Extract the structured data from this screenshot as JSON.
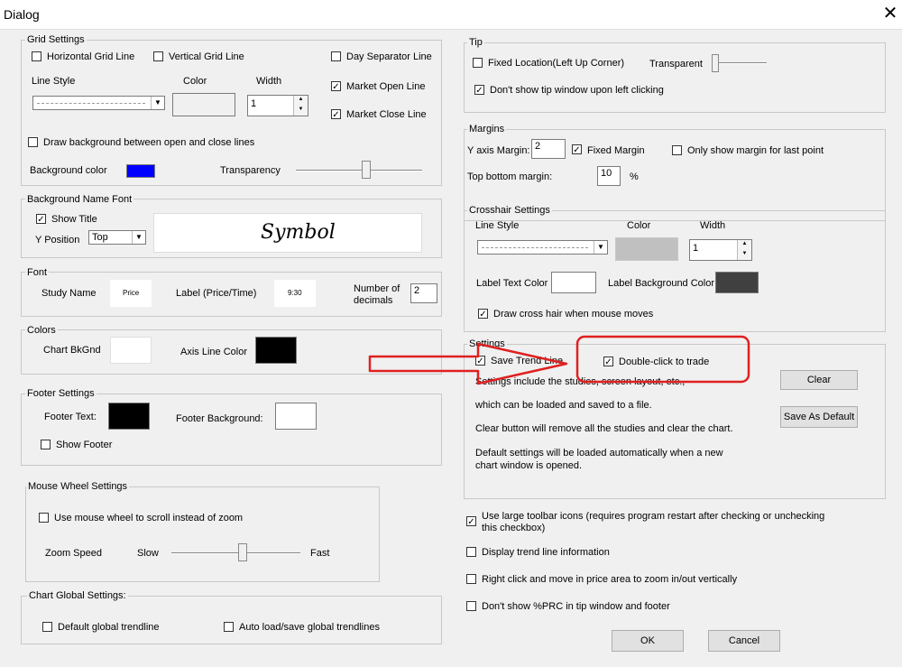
{
  "window": {
    "title": "Dialog",
    "close_glyph": "✕"
  },
  "grid": {
    "group": "Grid Settings",
    "horizontal": "Horizontal Grid Line",
    "vertical": "Vertical Grid Line",
    "day_sep": "Day Separator Line",
    "line_style": "Line Style",
    "color": "Color",
    "width": "Width",
    "width_value": "1",
    "line_color": "#3a3a3a",
    "market_open": "Market Open Line",
    "market_close": "Market Close Line",
    "draw_bg": "Draw background between open and close lines",
    "bg_color": "Background color",
    "bg_color_value": "#0000ff",
    "transparency": "Transparency"
  },
  "bgname": {
    "group": "Background Name Font",
    "show_title": "Show Title",
    "ypos": "Y Position",
    "ypos_value": "Top",
    "preview": "Symbol"
  },
  "font": {
    "group": "Font",
    "study_name": "Study Name",
    "study_preview": "Price",
    "label_pt": "Label (Price/Time)",
    "label_preview": "9:30",
    "num_dec": "Number of decimals",
    "num_dec_value": "2"
  },
  "colors": {
    "group": "Colors",
    "chart_bk": "Chart BkGnd",
    "chart_bk_value": "#ffffff",
    "axis_line": "Axis Line Color",
    "axis_line_value": "#000000"
  },
  "footer": {
    "group": "Footer Settings",
    "text": "Footer Text:",
    "text_color": "#000000",
    "bg": "Footer Background:",
    "bg_color": "#ffffff",
    "show": "Show Footer"
  },
  "mouse": {
    "group": "Mouse Wheel Settings",
    "scroll": "Use mouse wheel to scroll instead of zoom",
    "zoom_speed": "Zoom Speed",
    "slow": "Slow",
    "fast": "Fast"
  },
  "global": {
    "group": "Chart Global Settings:",
    "default_tl": "Default global trendline",
    "auto_load": "Auto load/save global trendlines"
  },
  "tip": {
    "group": "Tip",
    "fixed": "Fixed Location(Left Up Corner)",
    "transparent": "Transparent",
    "dont_show": "Don't show tip window upon left clicking"
  },
  "margins": {
    "group": "Margins",
    "y_axis": "Y axis Margin:",
    "y_axis_value": "2",
    "fixed": "Fixed Margin",
    "only_last": "Only show margin for last point",
    "top_bottom": "Top bottom margin:",
    "top_bottom_value": "10",
    "pct": "%"
  },
  "crosshair": {
    "group": "Crosshair Settings",
    "line_style": "Line Style",
    "color": "Color",
    "width": "Width",
    "width_value": "1",
    "line_color": "#c0c0c0",
    "label_text": "Label Text Color",
    "label_text_color": "#ffffff",
    "label_bg": "Label Background Color",
    "label_bg_color": "#404040",
    "draw": "Draw cross hair when mouse moves"
  },
  "settings": {
    "group": "Settings",
    "save_trend": "Save Trend Line",
    "double_click": "Double-click to trade",
    "desc1": "Settings include the studies, screen layout, etc.,",
    "desc2": "which can be loaded and saved to a file.",
    "desc3": "Clear button will remove all the studies and clear the chart.",
    "desc4": "Default settings will be loaded automatically when a new chart window is opened.",
    "clear": "Clear",
    "save_default": "Save As Default",
    "highlight_color": "#e02020"
  },
  "misc": {
    "large_icons": "Use large toolbar icons (requires program restart after checking or unchecking this checkbox)",
    "trend_info": "Display trend line information",
    "right_click": "Right click and move in price area to zoom in/out vertically",
    "no_prc": "Don't show %PRC in tip window and footer"
  },
  "buttons": {
    "ok": "OK",
    "cancel": "Cancel"
  }
}
